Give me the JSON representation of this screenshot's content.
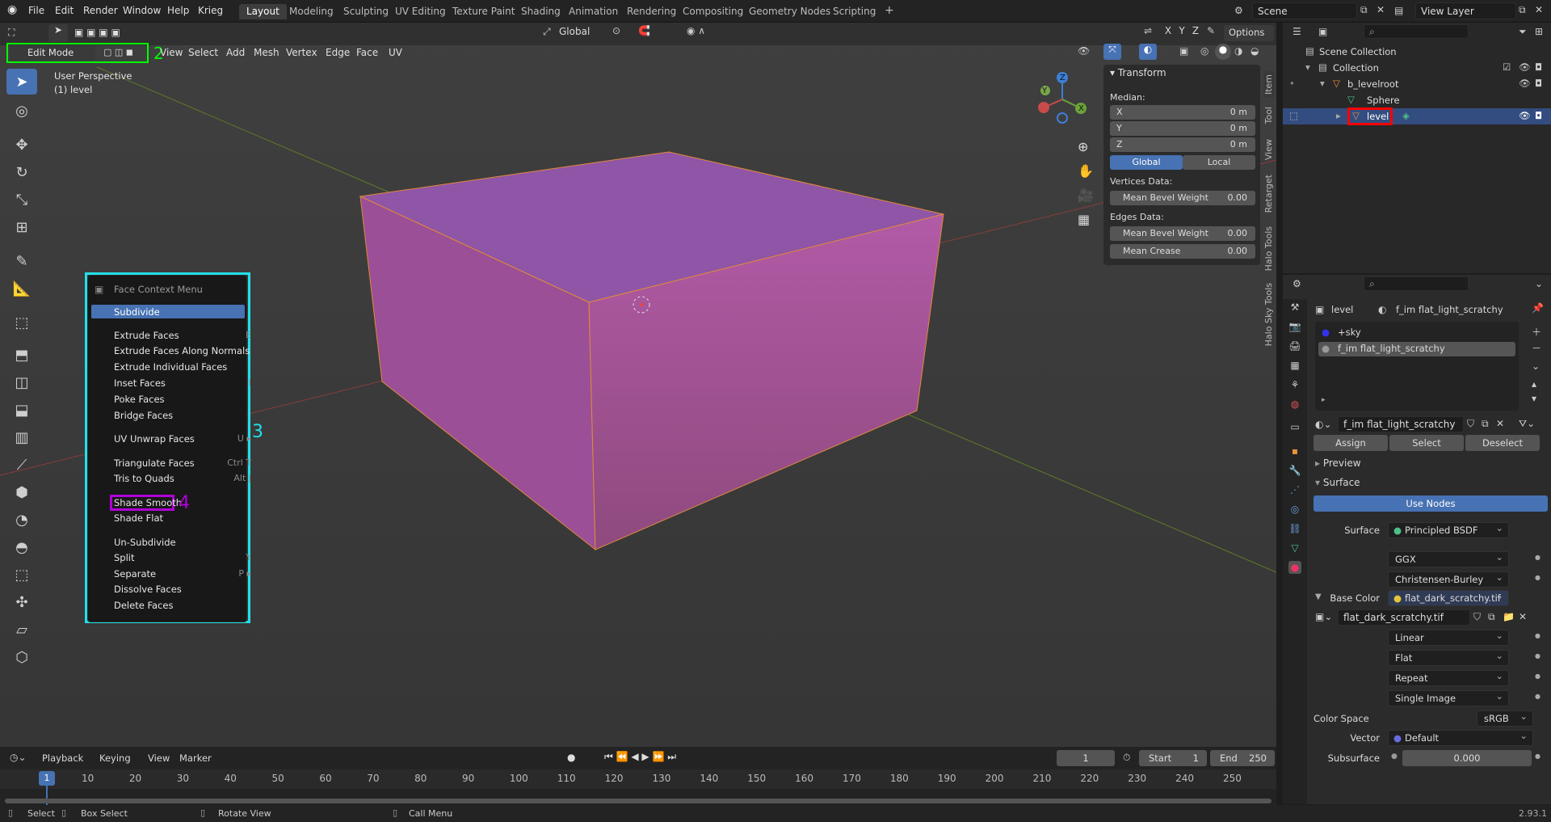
{
  "topbar": {
    "menus": [
      "File",
      "Edit",
      "Render",
      "Window",
      "Help",
      "Krieg"
    ],
    "workspaces": [
      "Layout",
      "Modeling",
      "Sculpting",
      "UV Editing",
      "Texture Paint",
      "Shading",
      "Animation",
      "Rendering",
      "Compositing",
      "Geometry Nodes",
      "Scripting"
    ],
    "active_workspace": "Layout",
    "add_tab": "+",
    "scene": "Scene",
    "view_layer": "View Layer"
  },
  "viewport_header": {
    "mode": "Edit Mode",
    "menus": [
      "View",
      "Select",
      "Add",
      "Mesh",
      "Vertex",
      "Edge",
      "Face",
      "UV"
    ],
    "transform_orientation": "Global",
    "options": "Options",
    "axes": [
      "X",
      "Y",
      "Z"
    ]
  },
  "viewport": {
    "perspective_label": "User Perspective",
    "object_label": "(1) level",
    "gizmo": {
      "x": "X",
      "y": "Y",
      "z": "Z"
    }
  },
  "annotations": {
    "n2": "2",
    "n3": "3",
    "n4": "4"
  },
  "context_menu": {
    "title": "Face Context Menu",
    "items": [
      {
        "label": "Subdivide",
        "shortcut": ""
      },
      {
        "label": "Extrude Faces",
        "shortcut": "E"
      },
      {
        "label": "Extrude Faces Along Normals",
        "shortcut": ""
      },
      {
        "label": "Extrude Individual Faces",
        "shortcut": ""
      },
      {
        "label": "Inset Faces",
        "shortcut": "I"
      },
      {
        "label": "Poke Faces",
        "shortcut": ""
      },
      {
        "label": "Bridge Faces",
        "shortcut": ""
      },
      {
        "label": "UV Unwrap Faces",
        "shortcut": "U ▸"
      },
      {
        "label": "Triangulate Faces",
        "shortcut": "Ctrl T"
      },
      {
        "label": "Tris to Quads",
        "shortcut": "Alt J"
      },
      {
        "label": "Shade Smooth",
        "shortcut": ""
      },
      {
        "label": "Shade Flat",
        "shortcut": ""
      },
      {
        "label": "Un-Subdivide",
        "shortcut": ""
      },
      {
        "label": "Split",
        "shortcut": "Y"
      },
      {
        "label": "Separate",
        "shortcut": "P ▸"
      },
      {
        "label": "Dissolve Faces",
        "shortcut": ""
      },
      {
        "label": "Delete Faces",
        "shortcut": ""
      }
    ]
  },
  "npanel": {
    "title": "Transform",
    "median": "Median:",
    "x_label": "X",
    "x_val": "0 m",
    "y_label": "Y",
    "y_val": "0 m",
    "z_label": "Z",
    "z_val": "0 m",
    "global": "Global",
    "local": "Local",
    "vertices_data": "Vertices Data:",
    "mean_bevel_weight": "Mean Bevel Weight",
    "vbw_val": "0.00",
    "edges_data": "Edges Data:",
    "ebw_val": "0.00",
    "mean_crease": "Mean Crease",
    "crease_val": "0.00",
    "tabs": [
      "Item",
      "Tool",
      "View",
      "Retarget",
      "Halo Tools",
      "Halo Sky Tools"
    ]
  },
  "outliner": {
    "scene_collection": "Scene Collection",
    "collection": "Collection",
    "b_levelroot": "b_levelroot",
    "sphere": "Sphere",
    "level": "level"
  },
  "properties": {
    "object": "level",
    "material": "f_im flat_light_scratchy",
    "slots": [
      "+sky",
      "f_im flat_light_scratchy"
    ],
    "material_field": "f_im flat_light_scratchy",
    "assign": "Assign",
    "select": "Select",
    "deselect": "Deselect",
    "preview": "Preview",
    "surface_panel": "Surface",
    "use_nodes": "Use Nodes",
    "surface_label": "Surface",
    "surface_val": "Principled BSDF",
    "ggx": "GGX",
    "subsurface_method": "Christensen-Burley",
    "base_color_label": "Base Color",
    "base_color_val": "flat_dark_scratchy.tif",
    "image_field": "flat_dark_scratchy.tif",
    "interp": "Linear",
    "proj": "Flat",
    "ext": "Repeat",
    "source": "Single Image",
    "color_space_label": "Color Space",
    "color_space": "sRGB",
    "vector_label": "Vector",
    "vector_val": "Default",
    "subsurface_label": "Subsurface",
    "subsurface_val": "0.000"
  },
  "timeline": {
    "menus": [
      "Playback",
      "Keying",
      "View",
      "Marker"
    ],
    "current": "1",
    "start_label": "Start",
    "start": "1",
    "end_label": "End",
    "end": "250",
    "ticks": [
      "1",
      "10",
      "20",
      "30",
      "40",
      "50",
      "60",
      "70",
      "80",
      "90",
      "100",
      "110",
      "120",
      "130",
      "140",
      "150",
      "160",
      "170",
      "180",
      "190",
      "200",
      "210",
      "220",
      "230",
      "240",
      "250"
    ]
  },
  "statusbar": {
    "select": "Select",
    "box_select": "Box Select",
    "rotate": "Rotate View",
    "call_menu": "Call Menu",
    "version": "2.93.1"
  },
  "colors": {
    "accent": "#4772b3",
    "highlight_green": "#00ff00",
    "highlight_cyan": "#22e0e8",
    "highlight_red": "#ff0000",
    "highlight_purple": "#b000d8"
  }
}
